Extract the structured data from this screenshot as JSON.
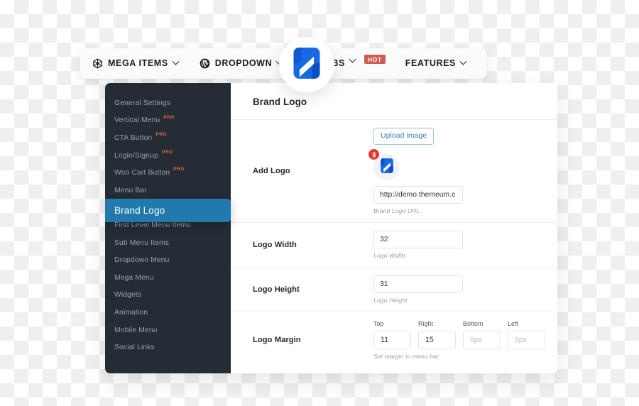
{
  "menubar": {
    "left_items": [
      {
        "label": "MEGA ITEMS",
        "icon": "hexagon-icon",
        "caret": true
      },
      {
        "label": "DROPDOWN",
        "icon": "wordpress-icon",
        "caret": true
      }
    ],
    "right_items": [
      {
        "label": "TABS",
        "icon": null,
        "caret": true,
        "badge": "HOT"
      },
      {
        "label": "FEATURES",
        "icon": null,
        "caret": true,
        "badge": null
      }
    ]
  },
  "brand_logo_icon": "themeum-logo-icon",
  "sidebar": {
    "items": [
      {
        "label": "General Settings",
        "pro": null,
        "active": false
      },
      {
        "label": "Vertical Menu",
        "pro": "PRO",
        "active": false
      },
      {
        "label": "CTA Button",
        "pro": "PRO",
        "active": false
      },
      {
        "label": "Login/Signup",
        "pro": "PRO",
        "active": false
      },
      {
        "label": "Woo Cart Button",
        "pro": "PRO",
        "active": false
      },
      {
        "label": "Menu Bar",
        "pro": null,
        "active": false
      },
      {
        "label": "Brand Logo",
        "pro": null,
        "active": true
      },
      {
        "label": "First Level Menu Items",
        "pro": null,
        "active": false
      },
      {
        "label": "Sub Menu Items",
        "pro": null,
        "active": false
      },
      {
        "label": "Dropdown Menu",
        "pro": null,
        "active": false
      },
      {
        "label": "Mega Menu",
        "pro": null,
        "active": false
      },
      {
        "label": "Widgets",
        "pro": null,
        "active": false
      },
      {
        "label": "Animation",
        "pro": null,
        "active": false
      },
      {
        "label": "Mobile Menu",
        "pro": null,
        "active": false
      },
      {
        "label": "Social Links",
        "pro": null,
        "active": false
      }
    ]
  },
  "content": {
    "title": "Brand Logo",
    "add_logo": {
      "label": "Add Logo",
      "upload_button": "Upload image",
      "delete_icon": "trash-icon",
      "thumb_icon": "themeum-logo-icon",
      "url_value": "http://demo.themeum.c",
      "url_placeholder": "http://",
      "url_note": "Brand Logo URL"
    },
    "logo_width": {
      "label": "Logo Width",
      "value": "32",
      "note": "Logo Width."
    },
    "logo_height": {
      "label": "Logo Height",
      "value": "31",
      "note": "Logo Height."
    },
    "logo_margin": {
      "label": "Logo Margin",
      "note": "Set margin to menu bar.",
      "fields": [
        {
          "caption": "Top",
          "value": "11",
          "placeholder": "0px"
        },
        {
          "caption": "Right",
          "value": "15",
          "placeholder": "0px"
        },
        {
          "caption": "Bottom",
          "value": "",
          "placeholder": "0px"
        },
        {
          "caption": "Left",
          "value": "",
          "placeholder": "0px"
        }
      ]
    }
  },
  "colors": {
    "sidebar_bg": "#252c36",
    "active_item": "#2179ac",
    "pro_badge": "#e2683c",
    "hot_badge": "#d15b54",
    "brand_blue": "#1668e3",
    "delete_red": "#e03a34",
    "upload_blue": "#3e7fb0"
  }
}
